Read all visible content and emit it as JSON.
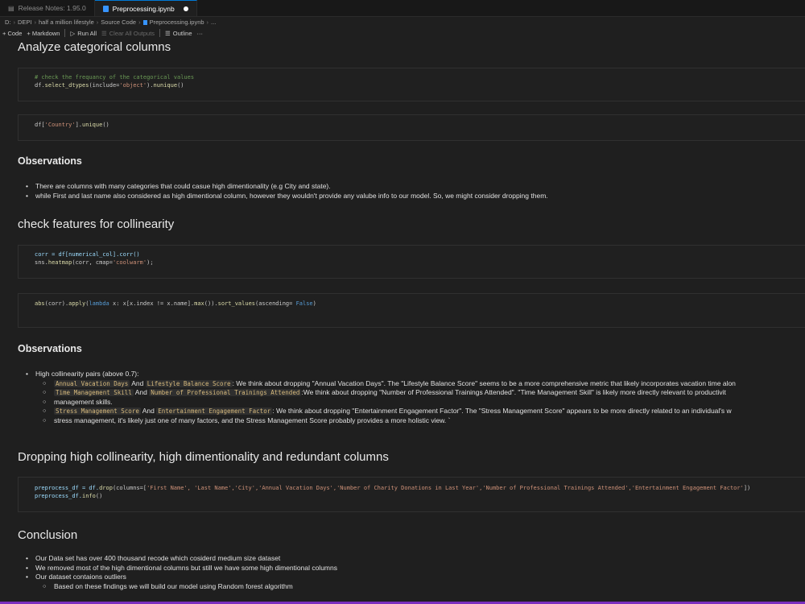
{
  "tabs": [
    {
      "label": "Release Notes: 1.95.0"
    },
    {
      "label": "Preprocessing.ipynb"
    }
  ],
  "breadcrumb": [
    "D:",
    "DEPI",
    "half a million lifestyle",
    "Source Code",
    "Preprocessing.ipynb",
    "..."
  ],
  "toolbar": {
    "code": "+ Code",
    "markdown": "+ Markdown",
    "run_all": "Run All",
    "clear_outputs": "Clear All Outputs",
    "outline": "Outline",
    "more": "···"
  },
  "sections": {
    "analyze": "Analyze categorical columns",
    "obs1": "Observations",
    "collinearity": "check features for collinearity",
    "obs2": "Observations",
    "dropping": "Dropping high collinearity, high dimentionality and redundant columns",
    "conclusion": "Conclusion"
  },
  "code": {
    "c1_comment": "# check the frequancy of the categorical values",
    "c1_l2a": "df.",
    "c1_l2b": "select_dtypes",
    "c1_l2c": "(include=",
    "c1_l2d": "'object'",
    "c1_l2e": ").",
    "c1_l2f": "nunique",
    "c1_l2g": "()",
    "c2_a": "df[",
    "c2_b": "'Country'",
    "c2_c": "].",
    "c2_d": "unique",
    "c2_e": "()",
    "c3_l1": "corr = df[numerical_col].corr()",
    "c3_l2a": "sns.",
    "c3_l2b": "heatmap",
    "c3_l2c": "(corr, cmap=",
    "c3_l2d": "'coolwarm'",
    "c3_l2e": ");",
    "c4_a": "abs",
    "c4_b": "(corr).",
    "c4_c": "apply",
    "c4_d": "(",
    "c4_e": "lambda",
    "c4_f": " x: x[x.index != x.name].",
    "c4_g": "max",
    "c4_h": "()).",
    "c4_i": "sort_values",
    "c4_j": "(ascending= ",
    "c4_k": "False",
    "c4_l": ")",
    "c5_l1a": "preprocess_df = df.",
    "c5_l1b": "drop",
    "c5_l1c": "(columns=[",
    "c5_l1d": "'First Name', 'Last Name','City','Annual Vacation Days','Number of Charity Donations in Last Year','Number of Professional Trainings Attended','Entertainment Engagement Factor'",
    "c5_l1e": "])",
    "c5_l2a": "preprocess_df.",
    "c5_l2b": "info",
    "c5_l2c": "()"
  },
  "obs1_items": [
    "There are columns with many categories that could casue high dimentionality (e.g City and state).",
    "while First and last name also considered as high dimentional column, however they wouldn't provide any valube info to our model. So, we might consider dropping them."
  ],
  "obs2": {
    "intro": "High collinearity pairs (above 0.7):",
    "p1_a": "Annual Vacation Days",
    "p1_and": " And ",
    "p1_b": "Lifestyle Balance Score",
    "p1_text": ": We think about dropping \"Annual Vacation Days\". The \"Lifestyle Balance Score\" seems to be a more comprehensive metric that likely incorporates vacation time alon",
    "p2_a": "Time Management Skill",
    "p2_and": " And ",
    "p2_b": "Number of Professional Trainings Attended",
    "p2_text": ":We think about dropping \"Number of Professional Trainings Attended\". \"Time Management Skill\" is likely more directly relevant to productivit",
    "p2_cont": "management skills.",
    "p3_a": "Stress Management Score",
    "p3_and": " And ",
    "p3_b": "Entertainment Engagement Factor",
    "p3_text": ": We think about dropping \"Entertainment Engagement Factor\". The \"Stress Management Score\" appears to be more directly related to an individual's w",
    "p3_cont": "stress management, it's likely just one of many factors, and the Stress Management Score probably provides a more holistic view. `"
  },
  "conclusion_items": [
    "Our Data set has over 400 thousand recode which cosiderd medium size dataset",
    "We removed most of the high dimentional columns but still we have some high dimentional columns",
    "Our dataset contaions outliers"
  ],
  "conclusion_sub": "Based on these findings we will build our model using Random forest algorithm"
}
